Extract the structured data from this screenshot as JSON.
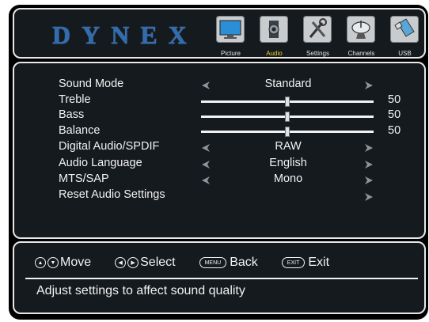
{
  "brand": "DYNEX",
  "tabs": [
    {
      "label": "Picture",
      "icon": "tv-icon",
      "active": false
    },
    {
      "label": "Audio",
      "icon": "speaker-icon",
      "active": true
    },
    {
      "label": "Settings",
      "icon": "tools-icon",
      "active": false
    },
    {
      "label": "Channels",
      "icon": "satellite-dish-icon",
      "active": false
    },
    {
      "label": "USB",
      "icon": "usb-drive-icon",
      "active": false
    }
  ],
  "settings": {
    "sound_mode": {
      "label": "Sound Mode",
      "value": "Standard"
    },
    "treble": {
      "label": "Treble",
      "value": "50",
      "level": 0.5
    },
    "bass": {
      "label": "Bass",
      "value": "50",
      "level": 0.5
    },
    "balance": {
      "label": "Balance",
      "value": "50",
      "level": 0.5
    },
    "digital_audio": {
      "label": "Digital Audio/SPDIF",
      "value": "RAW"
    },
    "audio_language": {
      "label": "Audio Language",
      "value": "English"
    },
    "mts_sap": {
      "label": "MTS/SAP",
      "value": "Mono"
    },
    "reset": {
      "label": "Reset Audio Settings"
    }
  },
  "footer": {
    "move_label": "Move",
    "select_label": "Select",
    "menu_key": "MENU",
    "back_label": "Back",
    "exit_key": "EXIT",
    "exit_label": "Exit",
    "help_text": "Adjust settings to affect sound quality"
  },
  "colors": {
    "accent": "#f3d02a",
    "brand": "#2f6db0",
    "background": "#141a1e"
  }
}
